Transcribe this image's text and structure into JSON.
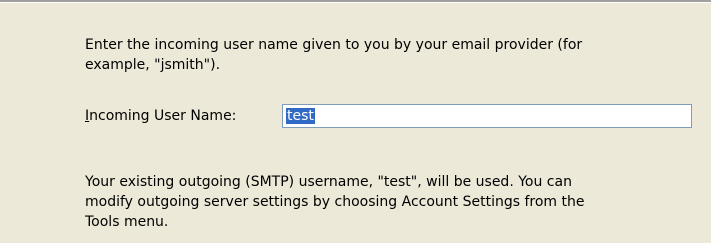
{
  "instructions": "Enter the incoming user name given to you by your email provider (for\nexample, \"jsmith\").",
  "incoming_user_name": {
    "label_mnemonic": "I",
    "label_rest": "ncoming User Name:",
    "value": "test"
  },
  "footer_note": "Your existing outgoing (SMTP) username, \"test\", will be used. You can\nmodify outgoing server settings by choosing Account Settings from the\nTools menu.",
  "colors": {
    "background": "#ece9d8",
    "selection": "#316ac5",
    "input_border": "#7f9db9"
  }
}
